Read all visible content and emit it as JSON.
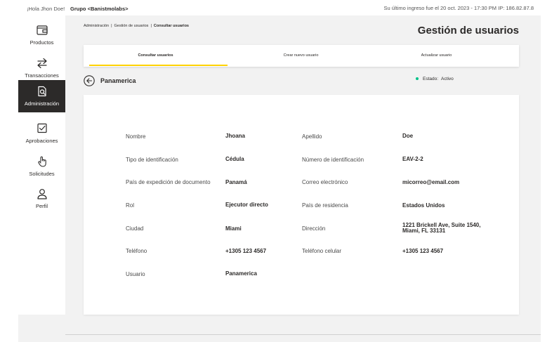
{
  "topbar": {
    "greeting": "¡Hola Jhon Doe!",
    "group": "Grupo <Banistmolabs>",
    "last_login": "Su último ingreso fue el 20 oct. 2023 - 17:30 PM IP: 186.82.87.8"
  },
  "sidebar": {
    "items": [
      {
        "label": "Productos",
        "icon": "wallet-icon"
      },
      {
        "label": "Transacciones",
        "icon": "transfer-arrows-icon"
      },
      {
        "label": "Administración",
        "icon": "document-search-icon",
        "active": true
      },
      {
        "label": "Aprobaciones",
        "icon": "checkbox-icon"
      },
      {
        "label": "Solicitudes",
        "icon": "hand-pointer-icon"
      },
      {
        "label": "Perfil",
        "icon": "user-icon"
      }
    ]
  },
  "breadcrumb": {
    "items": [
      "Administración",
      "Gestión de usuarios",
      "Consultar usuarios"
    ],
    "separator": "|"
  },
  "page_title": "Gestión de usuarios",
  "tabs": [
    {
      "label": "Consultar usuarios",
      "active": true
    },
    {
      "label": "Crear nuevo usuario"
    },
    {
      "label": "Actualizar usuario"
    }
  ],
  "entity": {
    "name": "Panamerica",
    "status_label": "Estado:",
    "status_value": "Activo"
  },
  "details": {
    "nombre_label": "Nombre",
    "nombre_value": "Jhoana",
    "apellido_label": "Apellido",
    "apellido_value": "Doe",
    "tipo_id_label": "Tipo de identificación",
    "tipo_id_value": "Cédula",
    "numero_id_label": "Número de identificación",
    "numero_id_value": "EAV-2-2",
    "pais_exp_label": "País de expedición de documento",
    "pais_exp_value": "Panamá",
    "correo_label": "Correo electrónico",
    "correo_value": "micorreo@email.com",
    "rol_label": "Rol",
    "rol_value": "Ejecutor directo",
    "pais_res_label": "País de residencia",
    "pais_res_value": "Estados Unidos",
    "ciudad_label": "Ciudad",
    "ciudad_value": "Miami",
    "direccion_label": "Dirección",
    "direccion_line1": "1221 Brickell Ave, Suite 1540,",
    "direccion_line2": "Miami, FL 33131",
    "telefono_label": "Teléfono",
    "telefono_value": "+1305 123 4567",
    "celular_label": "Teléfono celular",
    "celular_value": "+1305 123 4567",
    "usuario_label": "Usuario",
    "usuario_value": "Panamerica"
  },
  "colors": {
    "accent": "#ffd200",
    "sidebar_active": "#2c2a29",
    "status_active": "#00c389",
    "background": "#f2f2f2"
  }
}
